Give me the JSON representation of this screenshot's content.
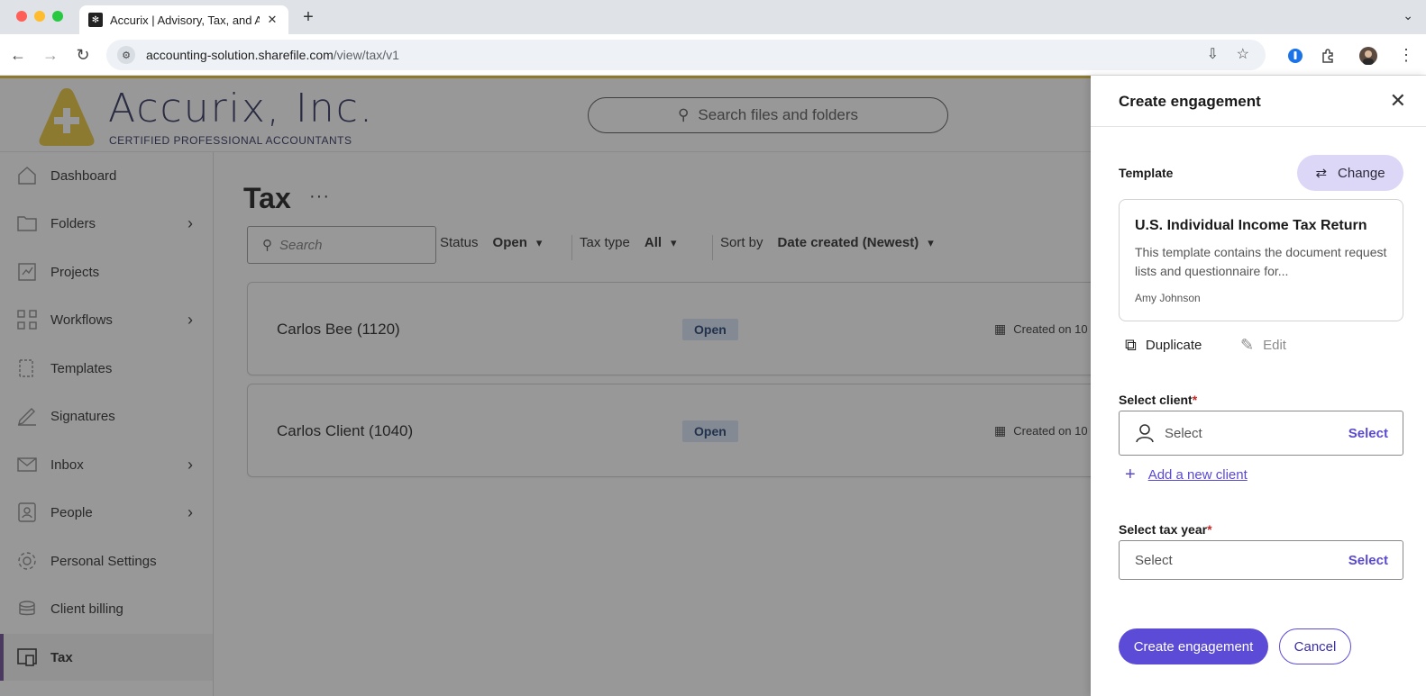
{
  "browser": {
    "tab_title": "Accurix | Advisory, Tax, and A",
    "tab_close": "✕",
    "new_tab": "+",
    "url_host": "accounting-solution.sharefile.com",
    "url_path": "/view/tax/v1"
  },
  "header": {
    "company_name": "Accurix, Inc.",
    "tagline": "CERTIFIED PROFESSIONAL ACCOUNTANTS",
    "search_placeholder": "Search files and folders",
    "brand_color": "#e9c63a"
  },
  "sidebar": {
    "items": [
      {
        "label": "Dashboard",
        "icon": "home-icon"
      },
      {
        "label": "Folders",
        "icon": "folder-icon",
        "has_children": true
      },
      {
        "label": "Projects",
        "icon": "projects-icon"
      },
      {
        "label": "Workflows",
        "icon": "workflows-icon",
        "has_children": true
      },
      {
        "label": "Templates",
        "icon": "templates-icon"
      },
      {
        "label": "Signatures",
        "icon": "signature-icon"
      },
      {
        "label": "Inbox",
        "icon": "mail-icon",
        "has_children": true
      },
      {
        "label": "People",
        "icon": "people-icon",
        "has_children": true
      },
      {
        "label": "Personal Settings",
        "icon": "gear-icon"
      },
      {
        "label": "Client billing",
        "icon": "billing-icon"
      },
      {
        "label": "Tax",
        "icon": "tax-icon",
        "active": true
      }
    ]
  },
  "main": {
    "title": "Tax",
    "more": "···",
    "search_placeholder": "Search",
    "filters": {
      "status_label": "Status",
      "status_value": "Open",
      "taxtype_label": "Tax type",
      "taxtype_value": "All",
      "sort_label": "Sort by",
      "sort_value": "Date created (Newest)"
    },
    "engagements": [
      {
        "name": "Carlos Bee (1120)",
        "status": "Open",
        "created": "Created on 10"
      },
      {
        "name": "Carlos Client (1040)",
        "status": "Open",
        "created": "Created on 10"
      }
    ]
  },
  "panel": {
    "title": "Create engagement",
    "template_label": "Template",
    "change_button": "Change",
    "template": {
      "name": "U.S. Individual Income Tax Return",
      "description": "This template contains the document request lists and questionnaire for...",
      "author": "Amy Johnson"
    },
    "duplicate_label": "Duplicate",
    "edit_label": "Edit",
    "client_label": "Select client",
    "client_placeholder": "Select",
    "client_select": "Select",
    "add_client": "Add a new client",
    "taxyear_label": "Select tax year",
    "taxyear_placeholder": "Select",
    "taxyear_select": "Select",
    "required_mark": "*",
    "create_button": "Create engagement",
    "cancel_button": "Cancel",
    "accent_color": "#5b4bd6"
  }
}
